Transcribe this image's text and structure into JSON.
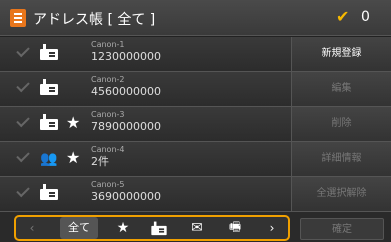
{
  "header": {
    "title": "アドレス帳 [ 全て ]",
    "count": "0",
    "check_icon": "checkmark-icon",
    "icon": "address-book-icon"
  },
  "entries": [
    {
      "type": "fax-icon",
      "favorite": false,
      "name": "Canon-1",
      "number": "1230000000"
    },
    {
      "type": "fax-icon",
      "favorite": false,
      "name": "Canon-2",
      "number": "4560000000"
    },
    {
      "type": "fax-icon",
      "favorite": true,
      "name": "Canon-3",
      "number": "7890000000"
    },
    {
      "type": "group-icon",
      "favorite": true,
      "name": "Canon-4",
      "number": "2件"
    },
    {
      "type": "fax-icon",
      "favorite": false,
      "name": "Canon-5",
      "number": "3690000000"
    }
  ],
  "side_buttons": [
    {
      "label": "新規登録",
      "enabled": true
    },
    {
      "label": "編集",
      "enabled": false
    },
    {
      "label": "削除",
      "enabled": false
    },
    {
      "label": "詳細情報",
      "enabled": false
    },
    {
      "label": "全選択解除",
      "enabled": false
    }
  ],
  "tabs": {
    "prev": "‹",
    "all": "全て",
    "favorites": "★",
    "fax": "fax-icon",
    "email": "✉",
    "ifax": "🖷",
    "next": "›"
  },
  "confirm_label": "確定",
  "colors": {
    "accent": "#f0a000",
    "header_icon": "#e8761c"
  }
}
